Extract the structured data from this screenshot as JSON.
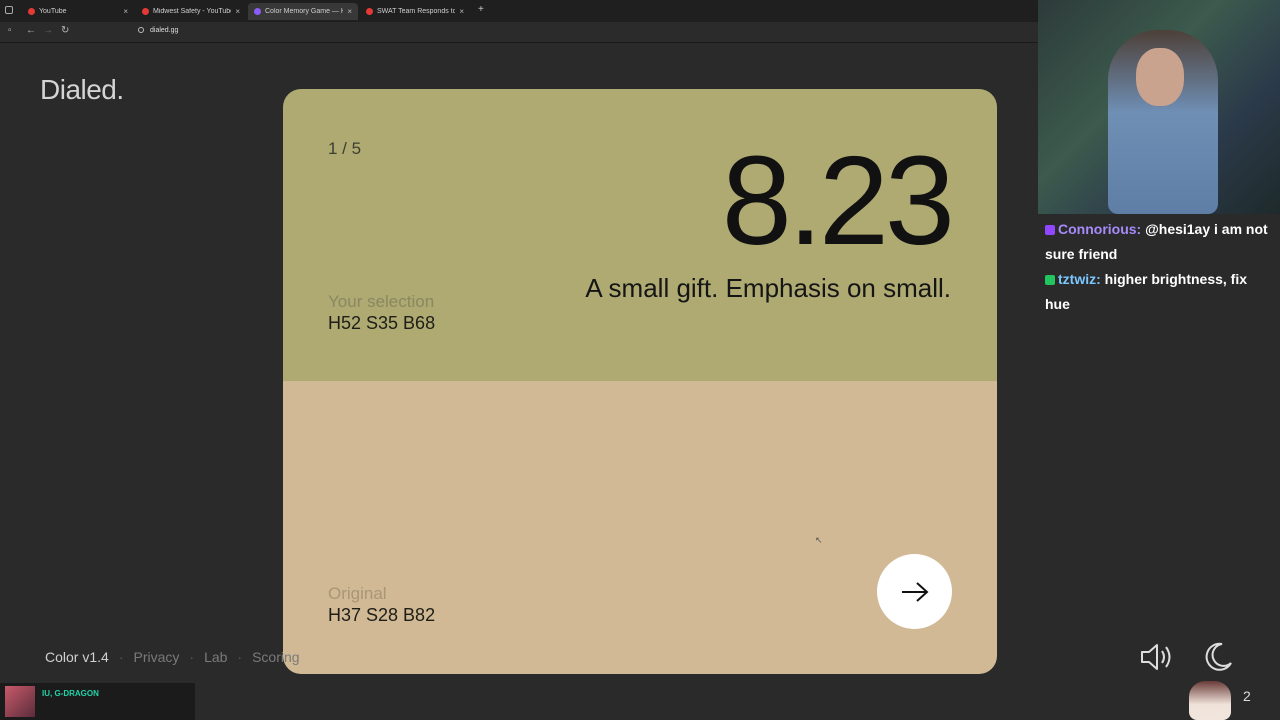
{
  "browser": {
    "tabs": [
      {
        "title": "YouTube",
        "color": "#e53935"
      },
      {
        "title": "Midwest Safety - YouTube",
        "color": "#e53935"
      },
      {
        "title": "Color Memory Game — H",
        "color": "#8b5cf6"
      },
      {
        "title": "SWAT Team Responds to Man's",
        "color": "#e53935"
      }
    ],
    "url": "dialed.gg"
  },
  "page": {
    "logo": "Dialed.",
    "round": "1 / 5",
    "score": "8.23",
    "tagline": "A small gift. Emphasis on small.",
    "selection_label": "Your selection",
    "selection_value": "H52 S35 B68",
    "original_label": "Original",
    "original_value": "H37 S28 B82",
    "selection_color": "#aeaa72",
    "original_color": "#d0b994",
    "next_icon": "arrow-right-icon"
  },
  "footer": {
    "links": [
      "Color v1.4",
      "Privacy",
      "Lab",
      "Scoring"
    ]
  },
  "chat": [
    {
      "user": "Connorious:",
      "text": "@hesi1ay i am not sure friend"
    },
    {
      "user": "tztwiz:",
      "text": "higher brightness, fix hue"
    }
  ],
  "music": {
    "title": "IU, G-DRAGON"
  },
  "viewers": "2"
}
